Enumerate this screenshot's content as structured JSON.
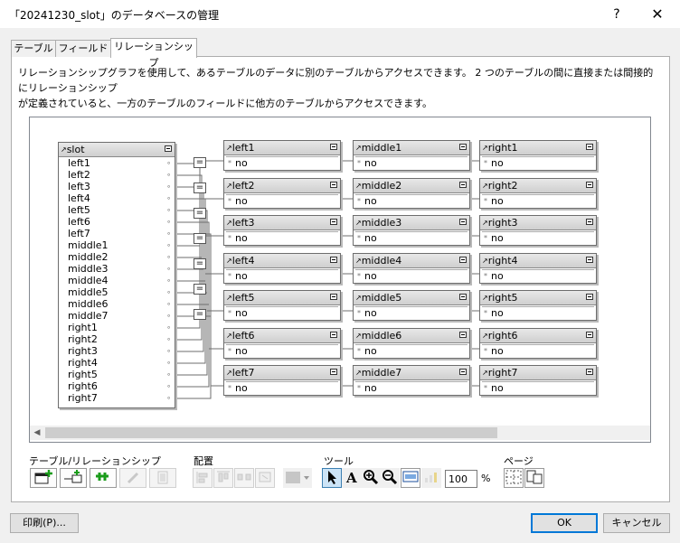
{
  "window": {
    "title": "「20241230_slot」のデータベースの管理",
    "help": "?",
    "close": "✕"
  },
  "tabs": [
    {
      "label": "テーブル",
      "active": false
    },
    {
      "label": "フィールド",
      "active": false
    },
    {
      "label": "リレーションシップ",
      "active": true
    }
  ],
  "description": {
    "line1": "リレーションシップグラフを使用して、あるテーブルのデータに別のテーブルからアクセスできます。 2 つのテーブルの間に直接または間接的にリレーションシップ",
    "line2": "が定義されていると、一方のテーブルのフィールドに他方のテーブルからアクセスできます。"
  },
  "graph": {
    "main_table": {
      "name": "slot",
      "fields": [
        "left1",
        "left2",
        "left3",
        "left4",
        "left5",
        "left6",
        "left7",
        "middle1",
        "middle2",
        "middle3",
        "middle4",
        "middle5",
        "middle6",
        "middle7",
        "right1",
        "right2",
        "right3",
        "right4",
        "right5",
        "right6",
        "right7"
      ]
    },
    "operator_symbol": "=",
    "columns": [
      {
        "tables": [
          {
            "name": "left1",
            "field": "no"
          },
          {
            "name": "left2",
            "field": "no"
          },
          {
            "name": "left3",
            "field": "no"
          },
          {
            "name": "left4",
            "field": "no"
          },
          {
            "name": "left5",
            "field": "no"
          },
          {
            "name": "left6",
            "field": "no"
          },
          {
            "name": "left7",
            "field": "no"
          }
        ]
      },
      {
        "tables": [
          {
            "name": "middle1",
            "field": "no"
          },
          {
            "name": "middle2",
            "field": "no"
          },
          {
            "name": "middle3",
            "field": "no"
          },
          {
            "name": "middle4",
            "field": "no"
          },
          {
            "name": "middle5",
            "field": "no"
          },
          {
            "name": "middle6",
            "field": "no"
          },
          {
            "name": "middle7",
            "field": "no"
          }
        ]
      },
      {
        "tables": [
          {
            "name": "right1",
            "field": "no"
          },
          {
            "name": "right2",
            "field": "no"
          },
          {
            "name": "right3",
            "field": "no"
          },
          {
            "name": "right4",
            "field": "no"
          },
          {
            "name": "right5",
            "field": "no"
          },
          {
            "name": "right6",
            "field": "no"
          },
          {
            "name": "right7",
            "field": "no"
          }
        ]
      }
    ]
  },
  "toolbar": {
    "groups": {
      "tables_relations": "テーブル/リレーションシップ",
      "arrange": "配置",
      "tools": "ツール",
      "page": "ページ"
    },
    "zoom": "100",
    "percent": "%"
  },
  "footer": {
    "print": "印刷(P)...",
    "ok": "OK",
    "cancel": "キャンセル"
  },
  "colors": {
    "accent": "#0078d7",
    "header": "#d9d9d9"
  }
}
